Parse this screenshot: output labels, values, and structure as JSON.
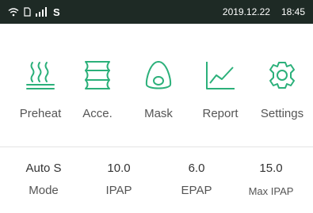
{
  "status_bar": {
    "network_letter": "S",
    "date": "2019.12.22",
    "time": "18:45"
  },
  "menu": {
    "items": [
      {
        "label": "Preheat",
        "icon": "heater-icon"
      },
      {
        "label": "Acce.",
        "icon": "accessory-icon"
      },
      {
        "label": "Mask",
        "icon": "mask-icon"
      },
      {
        "label": "Report",
        "icon": "chart-icon"
      },
      {
        "label": "Settings",
        "icon": "gear-icon"
      }
    ]
  },
  "parameters": [
    {
      "value": "Auto S",
      "label": "Mode"
    },
    {
      "value": "10.0",
      "label": "IPAP"
    },
    {
      "value": "6.0",
      "label": "EPAP"
    },
    {
      "value": "15.0",
      "label": "Max IPAP"
    }
  ],
  "colors": {
    "accent": "#2bb07a",
    "status_bar_bg": "#1e2a25",
    "text": "#555555"
  }
}
